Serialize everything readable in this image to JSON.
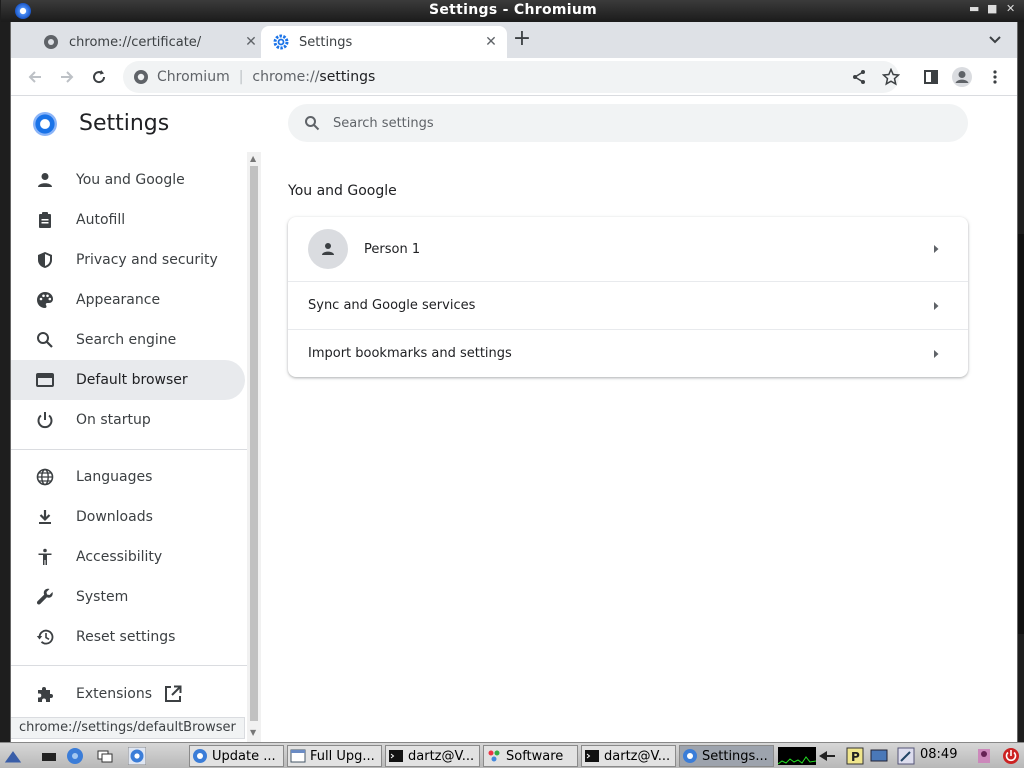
{
  "window": {
    "title": "Settings - Chromium"
  },
  "tabs": [
    {
      "label": "chrome://certificate/",
      "active": false
    },
    {
      "label": "Settings",
      "active": true
    }
  ],
  "toolbar": {
    "omnibox_chip": "Chromium",
    "omnibox_scheme": "chrome://",
    "omnibox_path": "settings"
  },
  "settings": {
    "title": "Settings",
    "search_placeholder": "Search settings",
    "nav": [
      {
        "label": "You and Google",
        "icon": "person-icon"
      },
      {
        "label": "Autofill",
        "icon": "clipboard-icon"
      },
      {
        "label": "Privacy and security",
        "icon": "shield-icon"
      },
      {
        "label": "Appearance",
        "icon": "palette-icon"
      },
      {
        "label": "Search engine",
        "icon": "search-icon"
      },
      {
        "label": "Default browser",
        "icon": "browser-icon",
        "selected": true
      },
      {
        "label": "On startup",
        "icon": "power-icon"
      },
      {
        "label": "Languages",
        "icon": "globe-icon"
      },
      {
        "label": "Downloads",
        "icon": "download-icon"
      },
      {
        "label": "Accessibility",
        "icon": "accessibility-icon"
      },
      {
        "label": "System",
        "icon": "wrench-icon"
      },
      {
        "label": "Reset settings",
        "icon": "history-icon"
      },
      {
        "label": "Extensions",
        "icon": "puzzle-icon"
      }
    ],
    "section_title": "You and Google",
    "rows": [
      {
        "label": "Person 1"
      },
      {
        "label": "Sync and Google services"
      },
      {
        "label": "Import bookmarks and settings"
      }
    ],
    "status_url": "chrome://settings/defaultBrowser"
  },
  "taskbar": {
    "items": [
      {
        "label": "Update ..."
      },
      {
        "label": "Full Upg..."
      },
      {
        "label": "dartz@V..."
      },
      {
        "label": "Software"
      },
      {
        "label": "dartz@V..."
      },
      {
        "label": "Settings...",
        "active": true
      }
    ],
    "clock": "08:49"
  },
  "colors": {
    "accent": "#1a73e8",
    "selected_bg": "#e8eaed",
    "tabstrip": "#dee1e6"
  }
}
